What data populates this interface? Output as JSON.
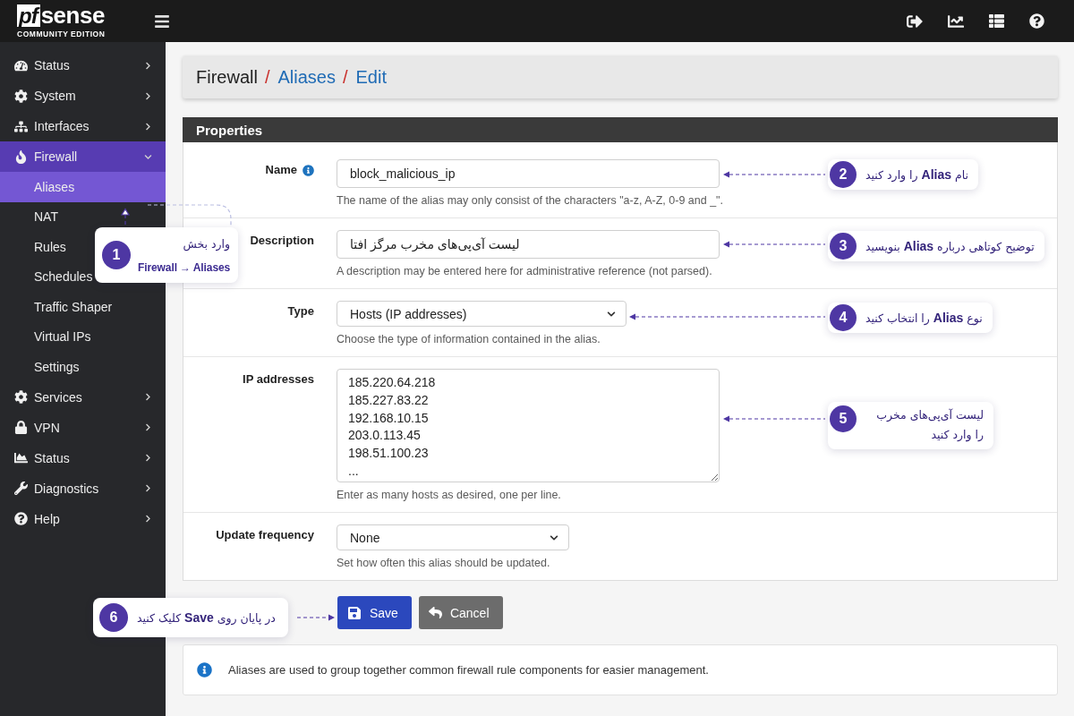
{
  "topbar": {
    "logo": {
      "mark": "pf",
      "name": "sense",
      "edition": "COMMUNITY EDITION"
    }
  },
  "sidebar": {
    "items": [
      {
        "label": "Status",
        "selected": false,
        "expanded": false
      },
      {
        "label": "System",
        "selected": false,
        "expanded": false
      },
      {
        "label": "Interfaces",
        "selected": false,
        "expanded": false
      },
      {
        "label": "Firewall",
        "selected": true,
        "expanded": true,
        "children": [
          {
            "label": "Aliases",
            "selected": true
          },
          {
            "label": "NAT",
            "selected": false
          },
          {
            "label": "Rules",
            "selected": false
          },
          {
            "label": "Schedules",
            "selected": false
          },
          {
            "label": "Traffic Shaper",
            "selected": false
          },
          {
            "label": "Virtual IPs",
            "selected": false
          },
          {
            "label": "Settings",
            "selected": false
          }
        ]
      },
      {
        "label": "Services",
        "selected": false,
        "expanded": false
      },
      {
        "label": "VPN",
        "selected": false,
        "expanded": false
      },
      {
        "label": "Status",
        "selected": false,
        "expanded": false
      },
      {
        "label": "Diagnostics",
        "selected": false,
        "expanded": false
      },
      {
        "label": "Help",
        "selected": false,
        "expanded": false
      }
    ],
    "callout": {
      "number": "1",
      "text": "وارد بخش",
      "subtext": "Firewall → Aliases"
    }
  },
  "breadcrumb": [
    {
      "label": "Firewall",
      "kind": "text",
      "separator": "/"
    },
    {
      "label": "Aliases",
      "kind": "link",
      "separator": "/"
    },
    {
      "label": "Edit",
      "kind": "link"
    }
  ],
  "properties": {
    "title": "Properties",
    "fields": [
      {
        "kind": "input",
        "label": "Name",
        "info": true,
        "value": "block_malicious_ip",
        "help": "The name of the alias may only consist of the characters \"a-z, A-Z, 0-9 and _\".",
        "callout": {
          "number": "2",
          "text": "نام **Alias** را وارد کنید"
        }
      },
      {
        "kind": "input",
        "label": "Description",
        "info": false,
        "value": "لیست آی‌پی‌های مخرب مرگز افتا",
        "help": "A description may be entered here for administrative reference (not parsed).",
        "callout": {
          "number": "3",
          "text": "توضیح کوتاهی درباره **Alias** بنویسید"
        }
      },
      {
        "kind": "select",
        "label": "Type",
        "info": false,
        "value": "Hosts (IP addresses)",
        "help": "Choose the type of information contained in the alias.",
        "callout": {
          "number": "4",
          "text": "نوع **Alias** را انتخاب کنید"
        }
      },
      {
        "kind": "textarea",
        "label": "IP addresses",
        "info": false,
        "value": "185.220.64.218\n185.227.83.22\n192.168.10.15\n203.0.113.45\n198.51.100.23\n...",
        "help": "Enter as many hosts as desired, one per line.",
        "callout": {
          "number": "5",
          "text": "لیست آی‌پی‌های مخرب را وارد کنید"
        }
      },
      {
        "kind": "select",
        "label": "Update frequency",
        "info": false,
        "value": "None",
        "help": "Set how often this alias should be updated."
      }
    ]
  },
  "actions": {
    "callout": {
      "number": "6",
      "text": "در پایان روی **Save** کلیک کنید"
    },
    "buttons": [
      {
        "label": "Save",
        "kind": "primary"
      },
      {
        "label": "Cancel",
        "kind": "secondary"
      }
    ]
  },
  "note": {
    "text": "Aliases are used to group together common firewall rule components for easier management."
  }
}
